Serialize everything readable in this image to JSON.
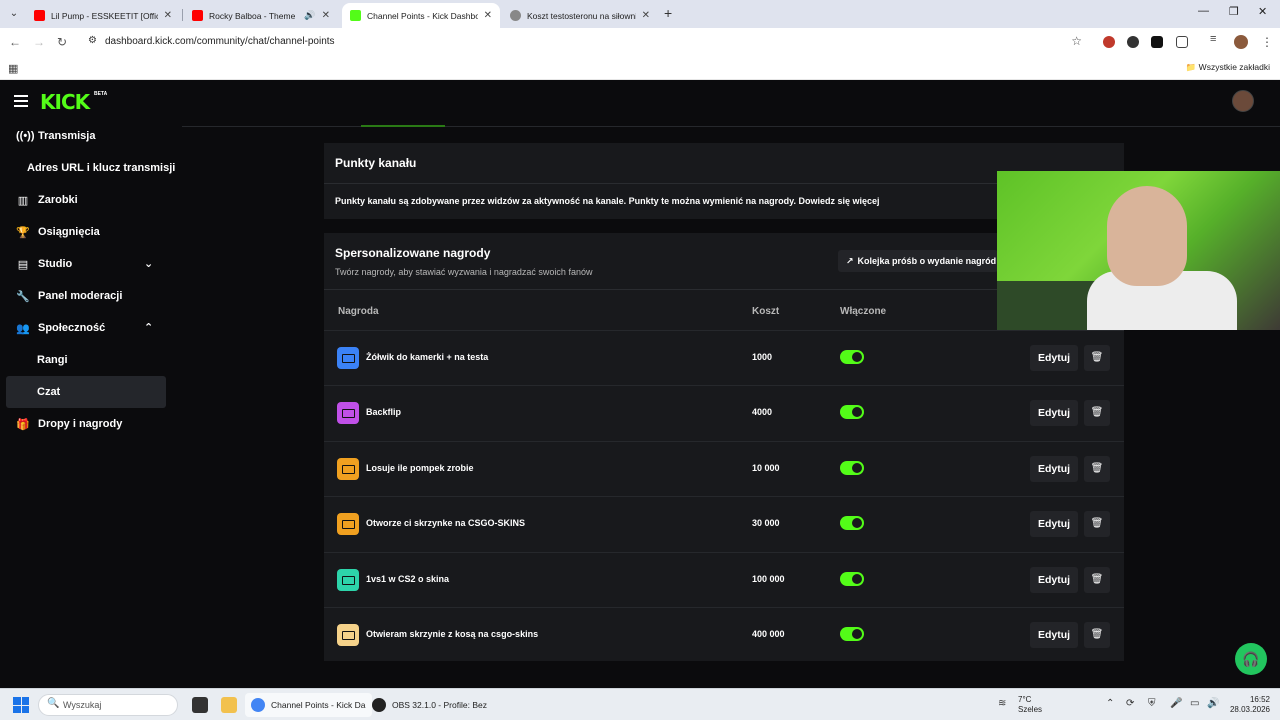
{
  "browser": {
    "tabs": [
      {
        "title": "Lil Pump - ESSKEETIT [Official M",
        "favicon_color": "#ff0000",
        "active": false
      },
      {
        "title": "Rocky Balboa - Theme Song",
        "favicon_color": "#ff0000",
        "active": false
      },
      {
        "title": "Channel Points - Kick Dashboard",
        "favicon_color": "#53fc18",
        "active": true
      },
      {
        "title": "Koszt testosteronu na siłowni",
        "favicon_color": "#888888",
        "active": false
      }
    ],
    "new_tab": "+",
    "url": "dashboard.kick.com/community/chat/channel-points",
    "bookmarks_all": "Wszystkie zakładki"
  },
  "kick": {
    "logo": "KICK",
    "logo_badge": "BETA",
    "accent": "#53fc18",
    "sidebar": [
      {
        "label": "Transmisja",
        "icon": "broadcast-icon"
      },
      {
        "label": "Adres URL i klucz transmisji",
        "icon": ""
      },
      {
        "label": "Zarobki",
        "icon": "chart-icon"
      },
      {
        "label": "Osiągnięcia",
        "icon": "trophy-icon"
      },
      {
        "label": "Studio",
        "icon": "studio-icon"
      },
      {
        "label": "Panel moderacji",
        "icon": "wrench-icon"
      },
      {
        "label": "Społeczność",
        "icon": "community-icon"
      },
      {
        "label": "Rangi",
        "icon": ""
      },
      {
        "label": "Czat",
        "icon": ""
      },
      {
        "label": "Dropy i nagrody",
        "icon": "gift-icon"
      }
    ],
    "channel_points": {
      "title": "Punkty kanału",
      "description": "Punkty kanału są zdobywane przez widzów za aktywność na kanale. Punkty te można wymienić na nagrody. Dowiedz się więcej"
    },
    "rewards": {
      "title": "Spersonalizowane nagrody",
      "subtitle": "Twórz nagrody, aby stawiać wyzwania i nagradzać swoich fanów",
      "queue_button": "Kolejka próśb o wydanie nagród",
      "columns": {
        "reward": "Nagroda",
        "cost": "Koszt",
        "enabled": "Włączone"
      },
      "edit_label": "Edytuj",
      "items": [
        {
          "name": "Żółwik do kamerki + na testa",
          "cost": "1000",
          "enabled": true,
          "color": "#3b82f6"
        },
        {
          "name": "Backflip",
          "cost": "4000",
          "enabled": true,
          "color": "#c050e8"
        },
        {
          "name": "Losuje ile pompek zrobie",
          "cost": "10 000",
          "enabled": true,
          "color": "#f0a020"
        },
        {
          "name": "Otworze ci skrzynke na CSGO-SKINS",
          "cost": "30 000",
          "enabled": true,
          "color": "#f0a020"
        },
        {
          "name": "1vs1 w CS2 o skina",
          "cost": "100 000",
          "enabled": true,
          "color": "#2dd4aa"
        },
        {
          "name": "Otwieram skrzynie z kosą na csgo-skins",
          "cost": "400 000",
          "enabled": true,
          "color": "#f5d28a"
        }
      ]
    }
  },
  "taskbar": {
    "search_placeholder": "Wyszukaj",
    "apps": [
      {
        "label": "Channel Points - Kick Da",
        "color": "#4285f4",
        "active": true
      },
      {
        "label": "OBS 32.1.0 - Profile: Bez",
        "color": "#222222",
        "active": false
      }
    ],
    "weather_temp": "7°C",
    "weather_desc": "Szeles",
    "time": "16:52",
    "date": "28.03.2026"
  }
}
